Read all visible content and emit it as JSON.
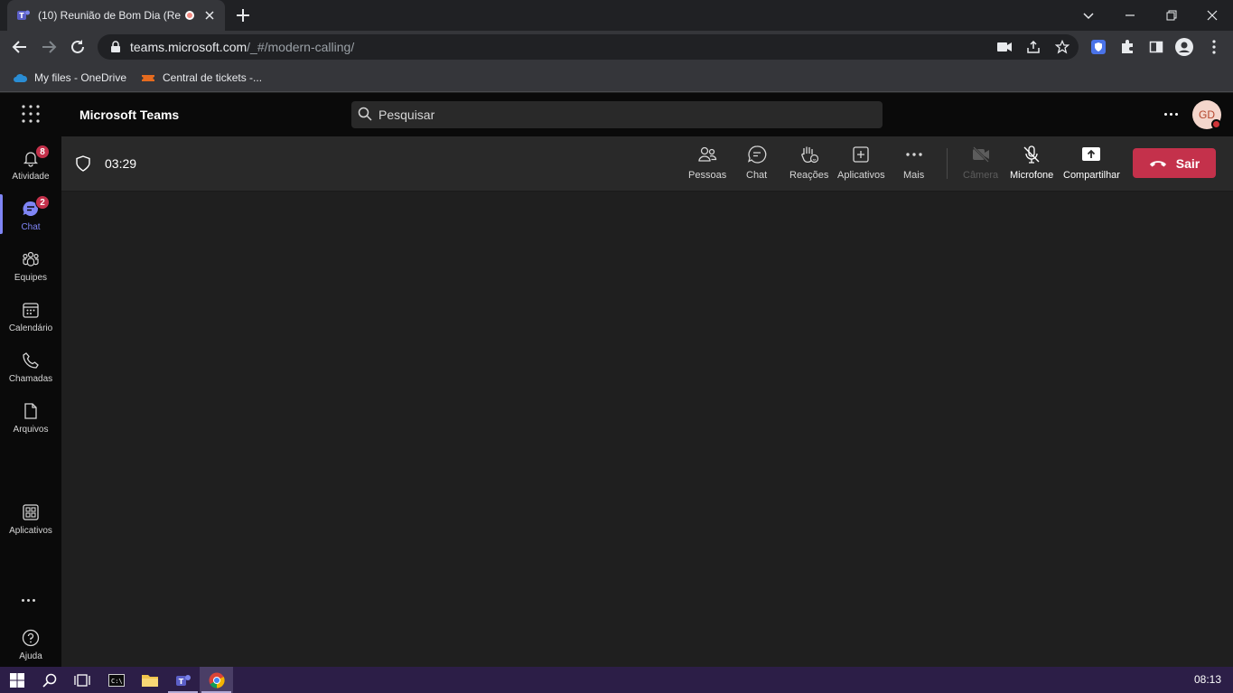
{
  "browser": {
    "tab_title": "(10) Reunião de Bom Dia (Re",
    "url_host": "teams.microsoft.com",
    "url_path": "/_#/modern-calling/",
    "bookmarks": [
      {
        "label": "My files - OneDrive",
        "icon": "onedrive-icon"
      },
      {
        "label": "Central de tickets -...",
        "icon": "ticket-icon"
      }
    ]
  },
  "teams": {
    "app_title": "Microsoft Teams",
    "search_placeholder": "Pesquisar",
    "avatar_initials": "GD",
    "rail": [
      {
        "label": "Atividade",
        "badge": "8",
        "icon": "bell-icon"
      },
      {
        "label": "Chat",
        "badge": "2",
        "icon": "chat-icon",
        "active": true
      },
      {
        "label": "Equipes",
        "icon": "teams-icon"
      },
      {
        "label": "Calendário",
        "icon": "calendar-icon"
      },
      {
        "label": "Chamadas",
        "icon": "phone-icon"
      },
      {
        "label": "Arquivos",
        "icon": "file-icon"
      },
      {
        "label": "Aplicativos",
        "icon": "apps-icon"
      },
      {
        "label": "Ajuda",
        "icon": "help-icon"
      }
    ]
  },
  "meeting": {
    "timer": "03:29",
    "controls": {
      "people": "Pessoas",
      "chat": "Chat",
      "reactions": "Reações",
      "apps": "Aplicativos",
      "more": "Mais",
      "camera": "Câmera",
      "microphone": "Microfone",
      "share": "Compartilhar"
    },
    "leave_label": "Sair"
  },
  "taskbar": {
    "clock": "08:13"
  },
  "colors": {
    "accent": "#7f85f5",
    "leave": "#c4314b",
    "badge": "#c4314b"
  }
}
